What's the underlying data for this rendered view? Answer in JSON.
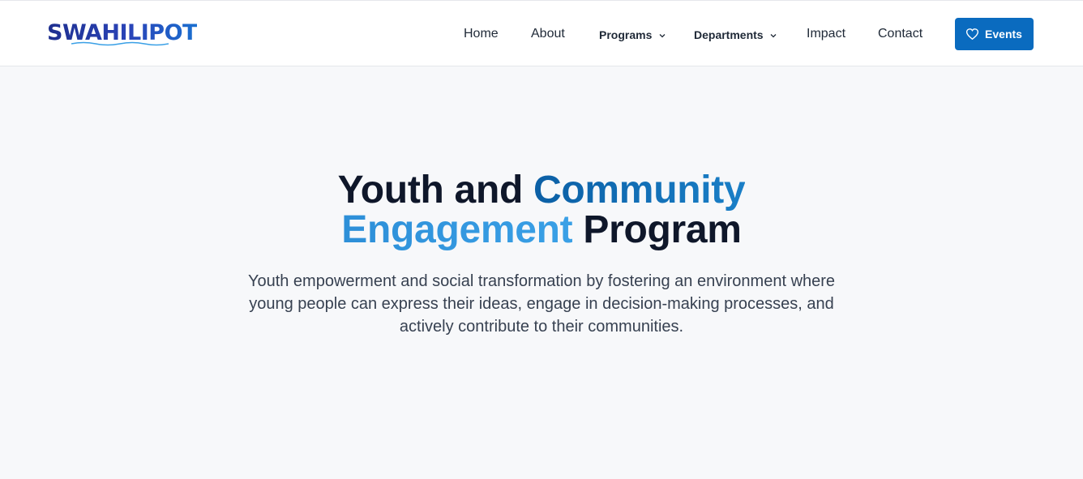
{
  "brand": {
    "logo_text": "SWAHILIPOT",
    "logo_colors": [
      "#1e2f8f",
      "#1a6fd0"
    ]
  },
  "nav": {
    "items": [
      {
        "label": "Home"
      },
      {
        "label": "About"
      },
      {
        "label": "Programs",
        "has_dropdown": true
      },
      {
        "label": "Departments",
        "has_dropdown": true
      },
      {
        "label": "Impact"
      },
      {
        "label": "Contact"
      }
    ],
    "cta": {
      "label": "Events",
      "icon": "heart-icon",
      "color": "#0a6bbf"
    }
  },
  "hero": {
    "title_part1": "Youth and ",
    "title_part2": "Community",
    "title_part3": "Engagement",
    "title_part4": " Program",
    "subtitle": "Youth empowerment and social transformation by fostering an environment where young people can express their ideas, engage in decision-making processes, and actively contribute to their communities.",
    "accent_colors": [
      "#0b5fa5",
      "#3aa0e6"
    ]
  }
}
